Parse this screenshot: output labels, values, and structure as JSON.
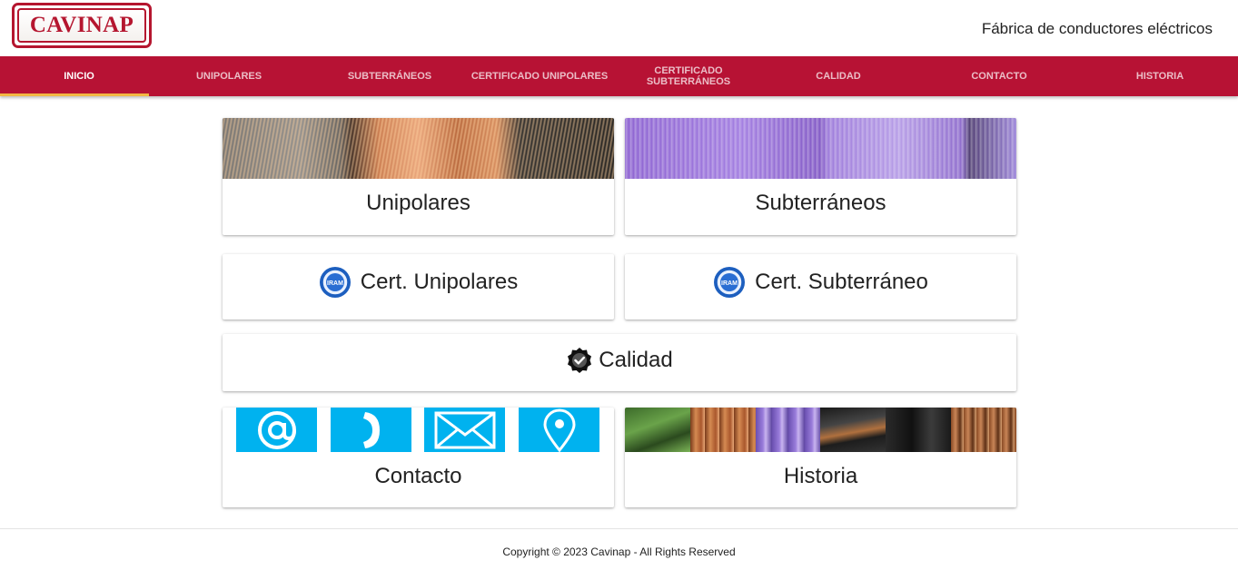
{
  "brand": {
    "logo_text": "CAVINAP",
    "tagline": "Fábrica de conductores eléctricos",
    "color": "#b71234"
  },
  "nav": {
    "items": [
      {
        "label": "INICIO"
      },
      {
        "label": "UNIPOLARES"
      },
      {
        "label": "SUBTERRÁNEOS"
      },
      {
        "label": "CERTIFICADO UNIPOLARES"
      },
      {
        "label": "CERTIFICADO SUBTERRÁNEOS"
      },
      {
        "label": "CALIDAD"
      },
      {
        "label": "CONTACTO"
      },
      {
        "label": "HISTORIA"
      }
    ],
    "active": "INICIO",
    "accent": "#f2b844"
  },
  "cards": {
    "unipolares": {
      "title": "Unipolares",
      "image_icon": "copper-cable-photo"
    },
    "subterraneos": {
      "title": "Subterráneos",
      "image_icon": "purple-cable-photo"
    },
    "cert_unipolares": {
      "title": "Cert. Unipolares",
      "icon": "iram-seal-icon"
    },
    "cert_subterraneo": {
      "title": "Cert. Subterráneo",
      "icon": "iram-seal-icon"
    },
    "calidad": {
      "title": "Calidad",
      "icon": "verified-badge-icon"
    },
    "contacto": {
      "title": "Contacto",
      "icons": [
        "at-icon",
        "phone-icon",
        "envelope-icon",
        "location-pin-icon"
      ],
      "icon_color": "#00b2ef"
    },
    "historia": {
      "title": "Historia",
      "image_icon": "cable-collage-photo"
    }
  },
  "footer": {
    "copyright": "Copyright © 2023 Cavinap - All Rights Reserved"
  }
}
